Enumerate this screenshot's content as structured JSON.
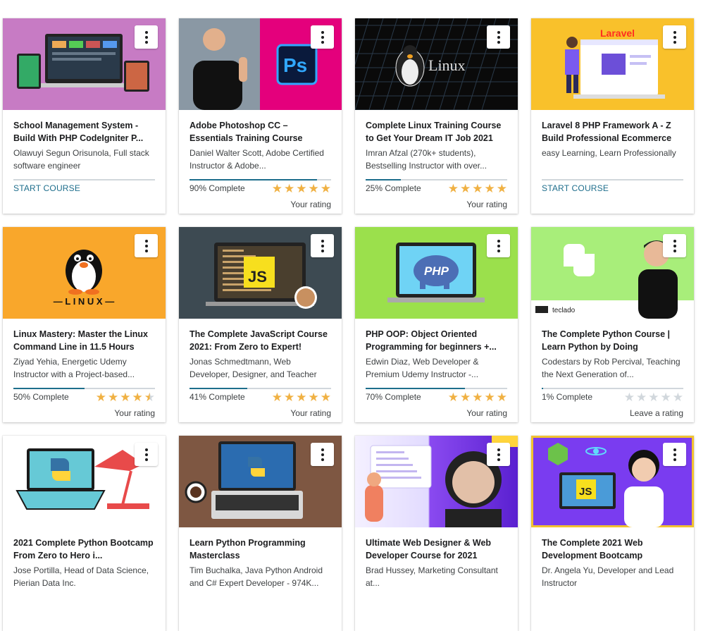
{
  "colors": {
    "accent": "#1e6e8c",
    "star": "#f0b143",
    "star_empty": "#d1d7dc"
  },
  "courses": [
    {
      "title": "School Management System - Build With PHP CodeIgniter P...",
      "author": "Olawuyi Segun Orisunola, Full stack software engineer",
      "action": "START COURSE",
      "progress": 0
    },
    {
      "title": "Adobe Photoshop CC – Essentials Training Course",
      "author": "Daniel Walter Scott, Adobe Certified Instructor & Adobe...",
      "status": "90% Complete",
      "progress": 0.9,
      "rating": 5,
      "rating_label": "Your rating"
    },
    {
      "title": "Complete Linux Training Course to Get Your Dream IT Job 2021",
      "author": "Imran Afzal (270k+ students), Bestselling Instructor with over...",
      "status": "25% Complete",
      "progress": 0.25,
      "rating": 5,
      "rating_label": "Your rating"
    },
    {
      "title": "Laravel 8 PHP Framework A - Z Build Professional Ecommerce",
      "author": "easy Learning, Learn Professionally",
      "action": "START COURSE",
      "progress": 0
    },
    {
      "title": "Linux Mastery: Master the Linux Command Line in 11.5 Hours",
      "author": "Ziyad Yehia, Energetic Udemy Instructor with a Project-based...",
      "status": "50% Complete",
      "progress": 0.5,
      "rating": 4.5,
      "rating_label": "Your rating"
    },
    {
      "title": "The Complete JavaScript Course 2021: From Zero to Expert!",
      "author": "Jonas Schmedtmann, Web Developer, Designer, and Teacher",
      "status": "41% Complete",
      "progress": 0.41,
      "rating": 5,
      "rating_label": "Your rating"
    },
    {
      "title": "PHP OOP: Object Oriented Programming for beginners +...",
      "author": "Edwin Diaz, Web Developer & Premium Udemy Instructor -...",
      "status": "70% Complete",
      "progress": 0.7,
      "rating": 5,
      "rating_label": "Your rating"
    },
    {
      "title": "The Complete Python Course | Learn Python by Doing",
      "author": "Codestars by Rob Percival, Teaching the Next Generation of...",
      "status": "1% Complete",
      "progress": 0.01,
      "rating": 0,
      "rating_label": "Leave a rating"
    },
    {
      "title": "2021 Complete Python Bootcamp From Zero to Hero i...",
      "author": "Jose Portilla, Head of Data Science, Pierian Data Inc."
    },
    {
      "title": "Learn Python Programming Masterclass",
      "author": "Tim Buchalka, Java Python Android and C# Expert Developer - 974K..."
    },
    {
      "title": "Ultimate Web Designer & Web Developer Course for 2021",
      "author": "Brad Hussey, Marketing Consultant at..."
    },
    {
      "title": "The Complete 2021 Web Development Bootcamp",
      "author": "Dr. Angela Yu, Developer and Lead Instructor"
    }
  ],
  "thumbnails": [
    {
      "icon": "devices-mockup-image",
      "bg": "#c77bc4"
    },
    {
      "icon": "photoshop-instructor-image",
      "bg": "#e4007c",
      "text": "Ps"
    },
    {
      "icon": "linux-tux-image",
      "bg": "#0a0a0a",
      "text": "Linux"
    },
    {
      "icon": "laravel-ecommerce-image",
      "bg": "#f9c12b",
      "text": "Laravel"
    },
    {
      "icon": "linux-penguin-image",
      "bg": "#f9a72b",
      "text": "— L I N U X —"
    },
    {
      "icon": "javascript-laptop-image",
      "bg": "#3d4a52",
      "text": "JS"
    },
    {
      "icon": "php-elephant-image",
      "bg": "#9be04c",
      "text": "PHP"
    },
    {
      "icon": "python-instructor-image",
      "bg": "#a8ee7a",
      "text": "teclado"
    },
    {
      "icon": "python-laptop-lamp-image",
      "bg": "#ffffff"
    },
    {
      "icon": "python-laptop-desk-image",
      "bg": "#6b4a3a"
    },
    {
      "icon": "web-designer-image",
      "bg": "#7a3cf0"
    },
    {
      "icon": "web-bootcamp-image",
      "bg": "#7a3cf0",
      "text": "JS"
    }
  ],
  "menu_icon": "more-vertical-icon"
}
